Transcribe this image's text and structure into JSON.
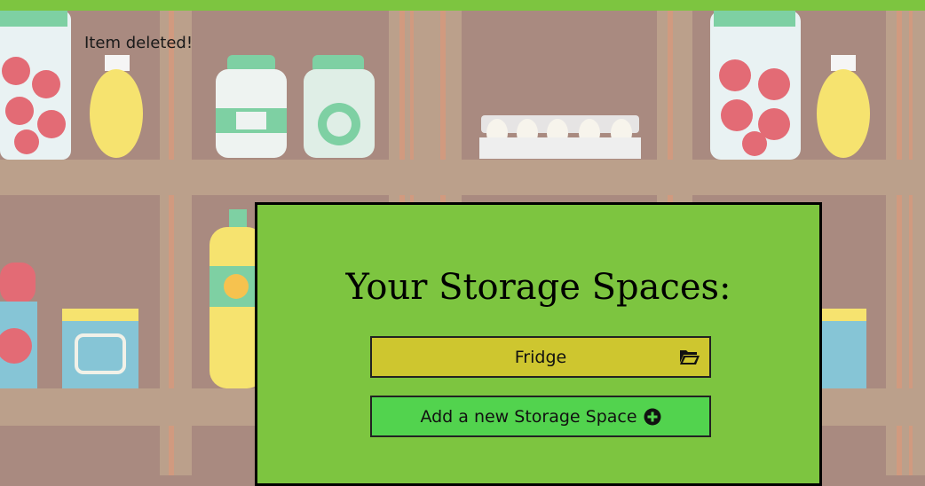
{
  "notification": {
    "text": "Item deleted!"
  },
  "storage": {
    "title": "Your Storage Spaces:",
    "spaces": [
      {
        "label": "Fridge",
        "icon": "folder-open-icon"
      }
    ],
    "add_label": "Add a new Storage Space",
    "add_icon": "plus-circle-icon"
  },
  "colors": {
    "accent_green": "#7dc540",
    "space_button": "#cec62f",
    "add_button": "#52d34e",
    "background": "#a98a80"
  }
}
